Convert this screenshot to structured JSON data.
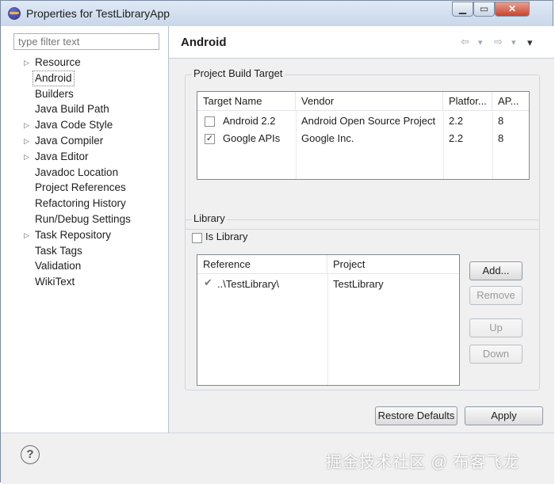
{
  "window": {
    "title": "Properties for TestLibraryApp",
    "controls": {
      "minimize": "▁",
      "maximize": "▭",
      "close": "✕"
    }
  },
  "filter": {
    "placeholder": "type filter text"
  },
  "tree": [
    {
      "label": "Resource",
      "expandable": true
    },
    {
      "label": "Android",
      "expandable": false,
      "selected": true
    },
    {
      "label": "Builders",
      "expandable": false
    },
    {
      "label": "Java Build Path",
      "expandable": false
    },
    {
      "label": "Java Code Style",
      "expandable": true
    },
    {
      "label": "Java Compiler",
      "expandable": true
    },
    {
      "label": "Java Editor",
      "expandable": true
    },
    {
      "label": "Javadoc Location",
      "expandable": false
    },
    {
      "label": "Project References",
      "expandable": false
    },
    {
      "label": "Refactoring History",
      "expandable": false
    },
    {
      "label": "Run/Debug Settings",
      "expandable": false
    },
    {
      "label": "Task Repository",
      "expandable": true
    },
    {
      "label": "Task Tags",
      "expandable": false
    },
    {
      "label": "Validation",
      "expandable": false
    },
    {
      "label": "WikiText",
      "expandable": false
    }
  ],
  "page": {
    "title": "Android",
    "nav": {
      "back_icon": "⇦",
      "forward_icon": "⇨",
      "dropdown_icon": "▾",
      "menu_icon": "▾"
    }
  },
  "build_target": {
    "group_label": "Project Build Target",
    "columns": [
      "Target Name",
      "Vendor",
      "Platfor...",
      "AP..."
    ],
    "rows": [
      {
        "checked": false,
        "name": "Android 2.2",
        "vendor": "Android Open Source Project",
        "platform": "2.2",
        "api": "8"
      },
      {
        "checked": true,
        "name": "Google APIs",
        "vendor": "Google Inc.",
        "platform": "2.2",
        "api": "8"
      }
    ]
  },
  "library": {
    "group_label": "Library",
    "is_library_label": "Is Library",
    "is_library_checked": false,
    "columns": [
      "Reference",
      "Project"
    ],
    "rows": [
      {
        "status_icon": "✔",
        "reference": "..\\TestLibrary\\",
        "project": "TestLibrary"
      }
    ],
    "buttons": {
      "add": "Add...",
      "remove": "Remove",
      "up": "Up",
      "down": "Down"
    }
  },
  "actions": {
    "restore_defaults": "Restore Defaults",
    "apply": "Apply",
    "help_icon": "?"
  },
  "watermark": "掘金技术社区 @ 布客飞龙"
}
